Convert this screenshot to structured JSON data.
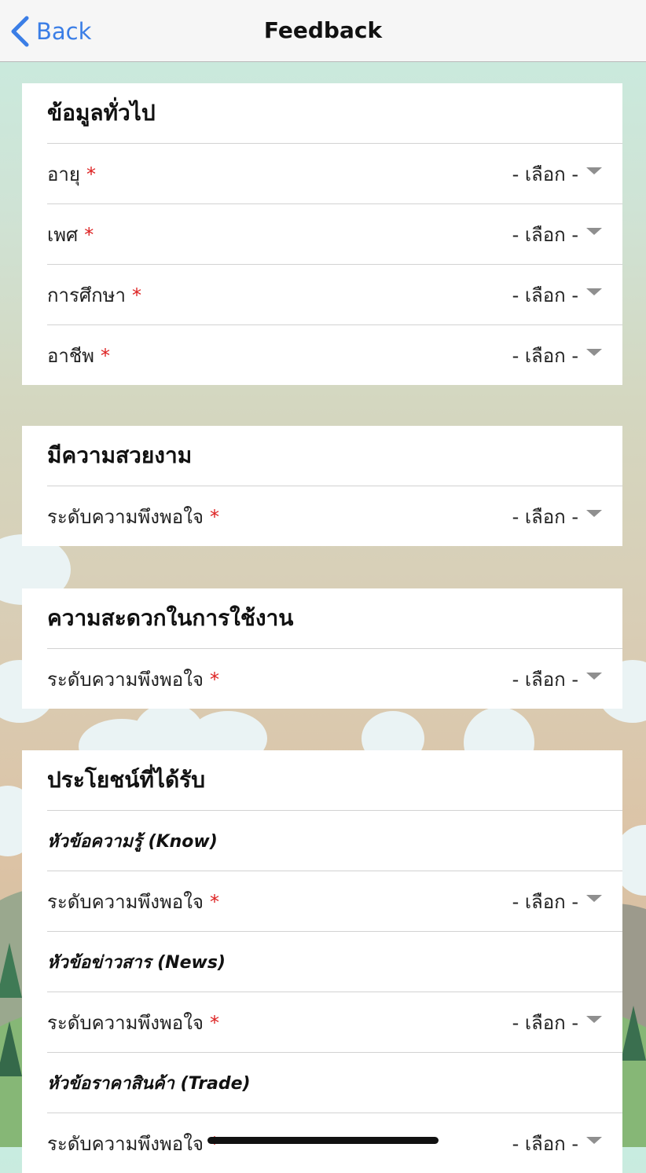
{
  "nav": {
    "back_label": "Back",
    "title": "Feedback"
  },
  "colors": {
    "accent": "#3b7ee6",
    "required": "#dd2222"
  },
  "select_placeholder": "- เลือก -",
  "sections": [
    {
      "title": "ข้อมูลทั่วไป",
      "rows": [
        {
          "type": "select",
          "label": "อายุ",
          "required": "*",
          "value": "- เลือก -"
        },
        {
          "type": "select",
          "label": "เพศ",
          "required": "*",
          "value": "- เลือก -"
        },
        {
          "type": "select",
          "label": "การศึกษา",
          "required": "*",
          "value": "- เลือก -"
        },
        {
          "type": "select",
          "label": "อาชีพ",
          "required": "*",
          "value": "- เลือก -"
        }
      ]
    },
    {
      "title": "มีความสวยงาม",
      "rows": [
        {
          "type": "select",
          "label": "ระดับความพึงพอใจ",
          "required": "*",
          "value": "- เลือก -"
        }
      ]
    },
    {
      "title": "ความสะดวกในการใช้งาน",
      "rows": [
        {
          "type": "select",
          "label": "ระดับความพึงพอใจ",
          "required": "*",
          "value": "- เลือก -"
        }
      ]
    },
    {
      "title": "ประโยชน์ที่ได้รับ",
      "rows": [
        {
          "type": "subhead",
          "label": "หัวข้อความรู้ (Know)"
        },
        {
          "type": "select",
          "label": "ระดับความพึงพอใจ",
          "required": "*",
          "value": "- เลือก -"
        },
        {
          "type": "subhead",
          "label": "หัวข้อข่าวสาร (News)"
        },
        {
          "type": "select",
          "label": "ระดับความพึงพอใจ",
          "required": "*",
          "value": "- เลือก -"
        },
        {
          "type": "subhead",
          "label": "หัวข้อราคาสินค้า (Trade)"
        },
        {
          "type": "select",
          "label": "ระดับความพึงพอใจ",
          "required": "*",
          "value": "- เลือก -"
        }
      ]
    }
  ]
}
